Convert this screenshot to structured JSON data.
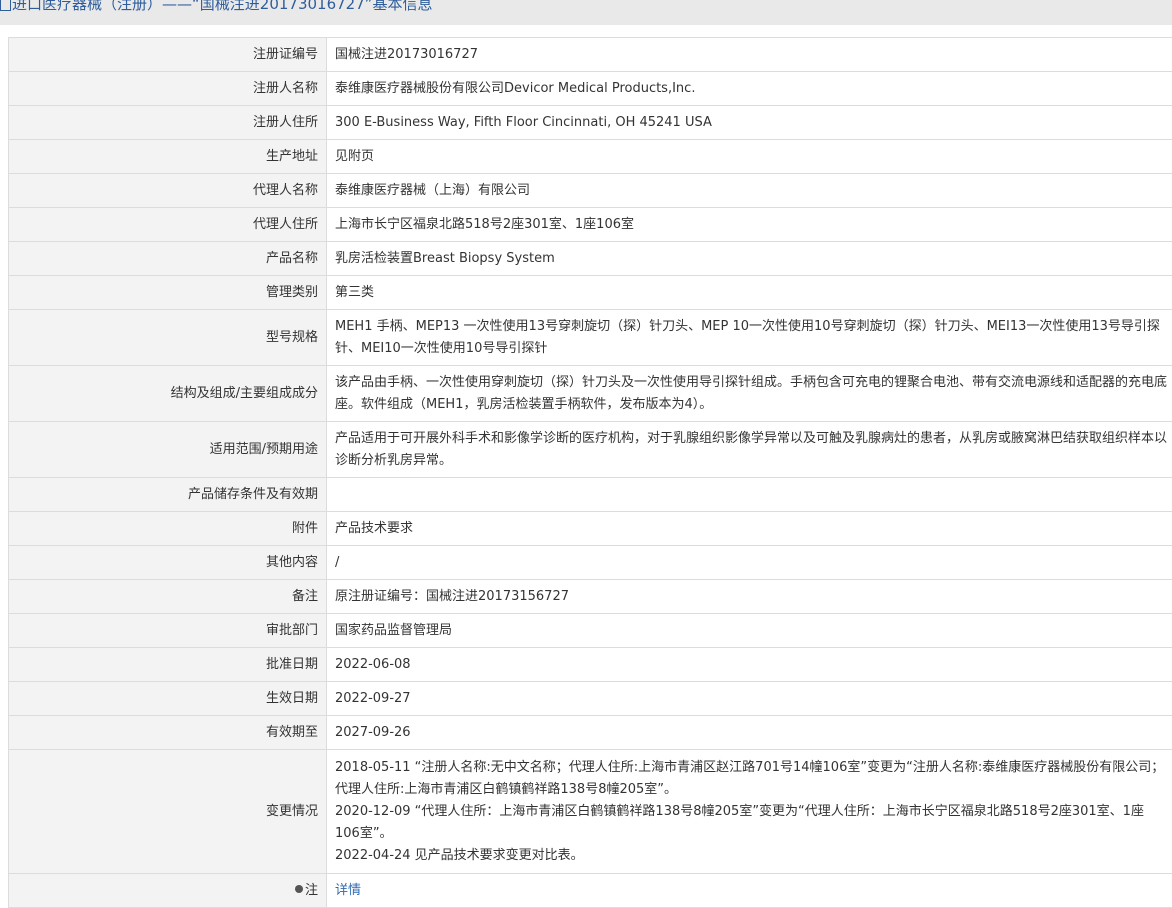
{
  "header": {
    "title": "进口医疗器械（注册）——“国械注进20173016727”基本信息"
  },
  "fields": [
    {
      "label": "注册证编号",
      "value": "国械注进20173016727"
    },
    {
      "label": "注册人名称",
      "value": "泰维康医疗器械股份有限公司Devicor Medical Products,Inc."
    },
    {
      "label": "注册人住所",
      "value": "300 E-Business Way, Fifth Floor Cincinnati, OH 45241 USA"
    },
    {
      "label": "生产地址",
      "value": "见附页"
    },
    {
      "label": "代理人名称",
      "value": "泰维康医疗器械（上海）有限公司"
    },
    {
      "label": "代理人住所",
      "value": "上海市长宁区福泉北路518号2座301室、1座106室"
    },
    {
      "label": "产品名称",
      "value": "乳房活检装置Breast Biopsy System"
    },
    {
      "label": "管理类别",
      "value": "第三类"
    },
    {
      "label": "型号规格",
      "value": "MEH1 手柄、MEP13 一次性使用13号穿刺旋切（探）针刀头、MEP 10一次性使用10号穿刺旋切（探）针刀头、MEI13一次性使用13号导引探针、MEI10一次性使用10号导引探针"
    },
    {
      "label": "结构及组成/主要组成成分",
      "value": "该产品由手柄、一次性使用穿刺旋切（探）针刀头及一次性使用导引探针组成。手柄包含可充电的锂聚合电池、带有交流电源线和适配器的充电底座。软件组成（MEH1，乳房活检装置手柄软件，发布版本为4）。"
    },
    {
      "label": "适用范围/预期用途",
      "value": "产品适用于可开展外科手术和影像学诊断的医疗机构，对于乳腺组织影像学异常以及可触及乳腺病灶的患者，从乳房或腋窝淋巴结获取组织样本以诊断分析乳房异常。"
    },
    {
      "label": "产品储存条件及有效期",
      "value": ""
    },
    {
      "label": "附件",
      "value": "产品技术要求"
    },
    {
      "label": "其他内容",
      "value": "/"
    },
    {
      "label": "备注",
      "value": "原注册证编号：国械注进20173156727"
    },
    {
      "label": "审批部门",
      "value": "国家药品监督管理局"
    },
    {
      "label": "批准日期",
      "value": "2022-06-08"
    },
    {
      "label": "生效日期",
      "value": "2022-09-27"
    },
    {
      "label": "有效期至",
      "value": "2027-09-26"
    }
  ],
  "changes": {
    "label": "变更情况",
    "entries": [
      "2018-05-11 “注册人名称:无中文名称；代理人住所:上海市青浦区赵江路701号14幢106室”变更为“注册人名称:泰维康医疗器械股份有限公司；代理人住所:上海市青浦区白鹤镇鹤祥路138号8幢205室”。",
      "2020-12-09 “代理人住所：上海市青浦区白鹤镇鹤祥路138号8幢205室”变更为“代理人住所：上海市长宁区福泉北路518号2座301室、1座106室”。",
      "2022-04-24 见产品技术要求变更对比表。"
    ]
  },
  "note": {
    "label": "注",
    "icon": "lightbulb-icon",
    "link_text": "详情"
  }
}
